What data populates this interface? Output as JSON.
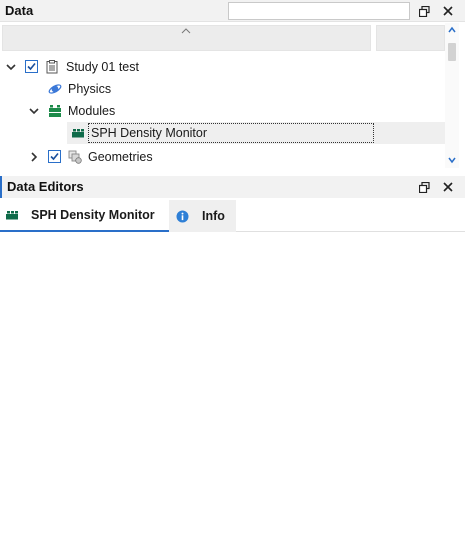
{
  "data_panel": {
    "title": "Data",
    "search_value": "",
    "tree": {
      "study": {
        "label": "Study 01 test",
        "checked": true,
        "expanded": true
      },
      "physics": {
        "label": "Physics"
      },
      "modules": {
        "label": "Modules",
        "expanded": true
      },
      "module_item": {
        "label": "SPH Density Monitor",
        "selected": true
      },
      "geometries": {
        "label": "Geometries",
        "checked": true,
        "expanded": false
      }
    }
  },
  "editors_panel": {
    "title": "Data Editors",
    "tabs": [
      {
        "label": "SPH Density Monitor",
        "icon": "modules-icon",
        "active": true
      },
      {
        "label": "Info",
        "icon": "info-icon",
        "active": false
      }
    ]
  },
  "colors": {
    "accent": "#2a6fc9",
    "module_green": "#1d8a4a",
    "info_blue": "#2e7fd6"
  }
}
